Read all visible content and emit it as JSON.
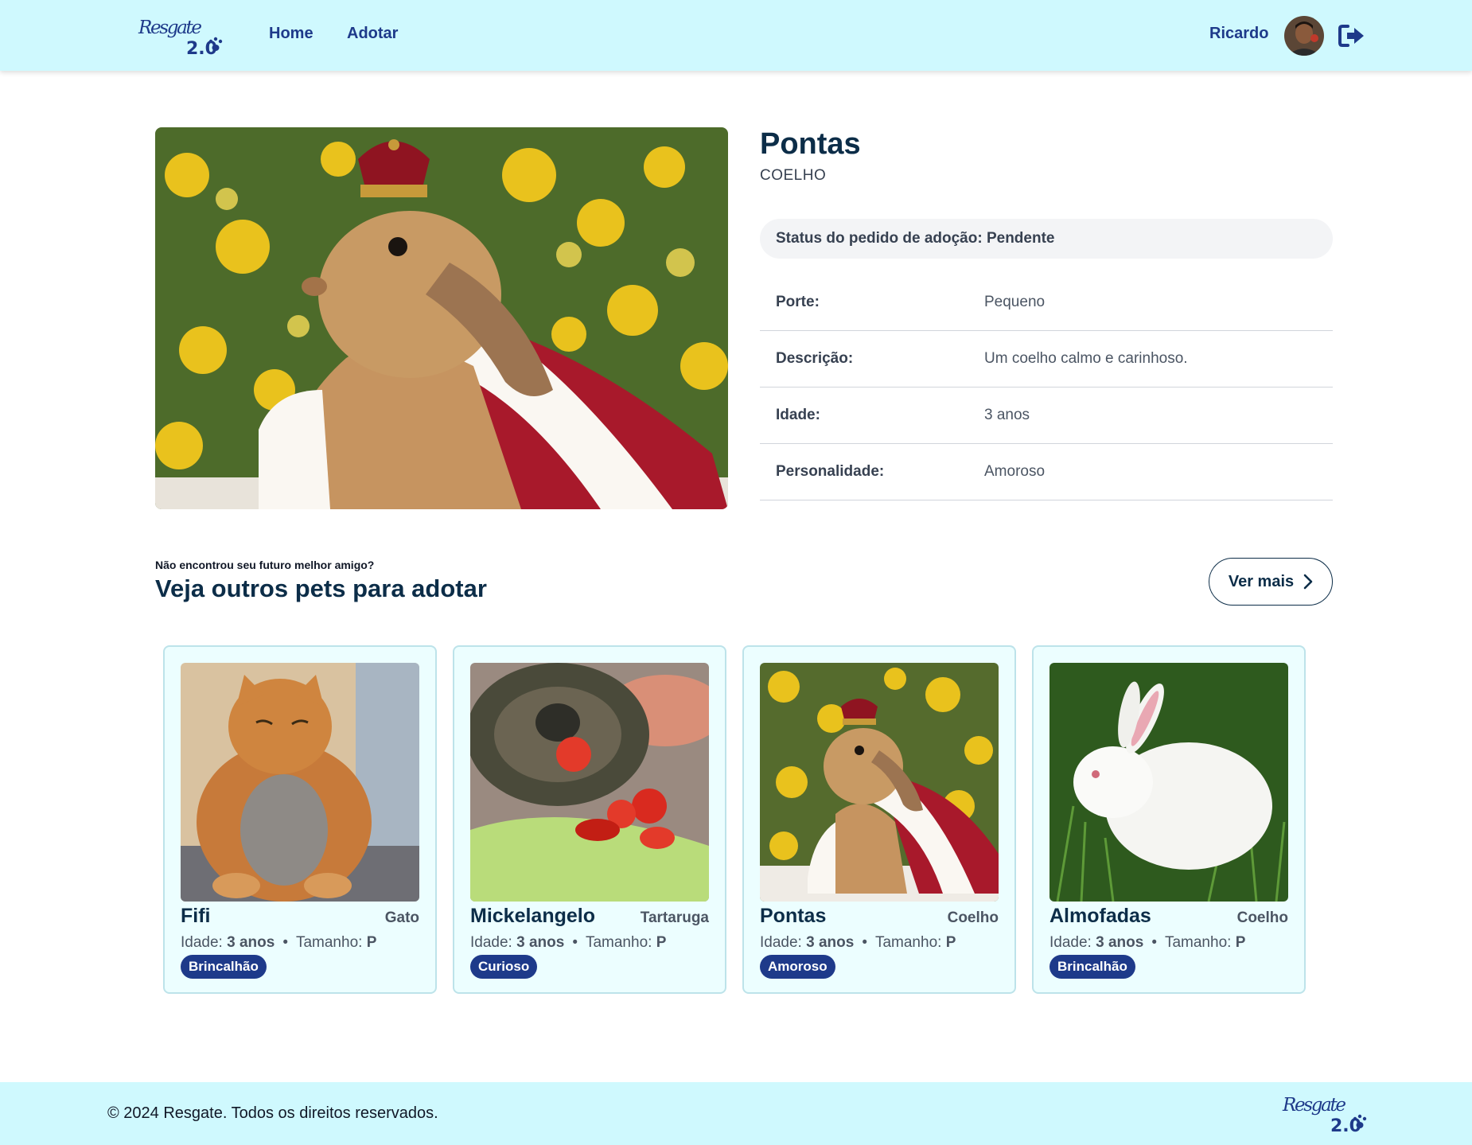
{
  "brand": {
    "logo_text": "Resgate",
    "logo_version": "2.0"
  },
  "header": {
    "nav": [
      {
        "label": "Home"
      },
      {
        "label": "Adotar"
      }
    ],
    "user_name": "Ricardo",
    "logout_icon": "sign-out-icon"
  },
  "pet": {
    "name": "Pontas",
    "species": "COELHO",
    "status_text": "Status do pedido de adoção: Pendente",
    "details": [
      {
        "label": "Porte:",
        "value": "Pequeno"
      },
      {
        "label": "Descrição:",
        "value": "Um coelho calmo e carinhoso."
      },
      {
        "label": "Idade:",
        "value": "3 anos"
      },
      {
        "label": "Personalidade:",
        "value": "Amoroso"
      }
    ]
  },
  "others": {
    "kicker": "Não encontrou seu futuro melhor amigo?",
    "title": "Veja outros pets para adotar",
    "more_label": "Ver mais",
    "age_label": "Idade:",
    "size_label": "Tamanho:",
    "cards": [
      {
        "name": "Fifi",
        "species": "Gato",
        "age": "3 anos",
        "size": "P",
        "badge": "Brincalhão"
      },
      {
        "name": "Mickelangelo",
        "species": "Tartaruga",
        "age": "3 anos",
        "size": "P",
        "badge": "Curioso"
      },
      {
        "name": "Pontas",
        "species": "Coelho",
        "age": "3 anos",
        "size": "P",
        "badge": "Amoroso"
      },
      {
        "name": "Almofadas",
        "species": "Coelho",
        "age": "3 anos",
        "size": "P",
        "badge": "Brincalhão"
      }
    ]
  },
  "footer": {
    "copyright": "© 2024 Resgate. Todos os direitos reservados."
  },
  "colors": {
    "header_bg": "#cff9fe",
    "brand_blue": "#1e3a8a",
    "dark_navy": "#0c2d48",
    "card_bg": "#ecfeff"
  }
}
